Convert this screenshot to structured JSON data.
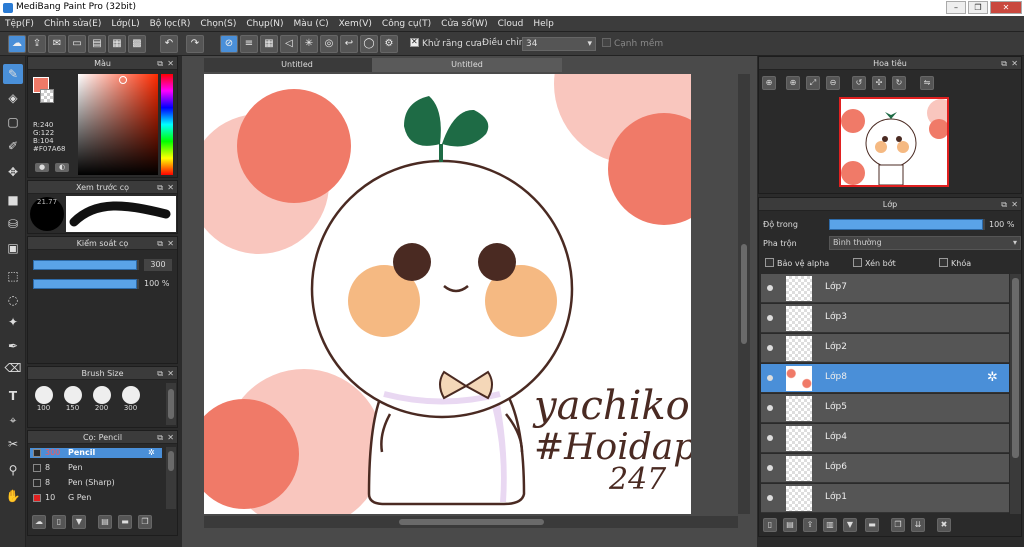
{
  "window": {
    "title": "MediBang Paint Pro (32bit)"
  },
  "menu": [
    "Tệp(F)",
    "Chỉnh sửa(E)",
    "Lớp(L)",
    "Bộ lọc(R)",
    "Chọn(S)",
    "Chụp(N)",
    "Màu (C)",
    "Xem(V)",
    "Công cụ(T)",
    "Cửa sổ(W)",
    "Cloud",
    "Help"
  ],
  "toolbar": {
    "antialias_label": "Khử răng cưa",
    "correction_label": "Điều chỉnh",
    "correction_value": "34",
    "edge_label": "Cạnh mềm"
  },
  "color_panel": {
    "title": "Màu",
    "r": "R:240",
    "g": "G:122",
    "b": "B:104",
    "hex": "#F07A68",
    "primary": "#F07A68"
  },
  "brush_preview": {
    "title": "Xem trước cọ",
    "size": "21.77"
  },
  "brush_control": {
    "title": "Kiểm soát cọ",
    "size": "300",
    "opacity": "100 %",
    "size_fraction": 1.0,
    "opacity_fraction": 1.0
  },
  "brush_size": {
    "title": "Brush Size",
    "sizes": [
      "100",
      "150",
      "200",
      "300"
    ]
  },
  "brush_list": {
    "title": "Cọ: Pencil",
    "items": [
      {
        "size": "300",
        "name": "Pencil",
        "color": "#2a2a2a",
        "selected": true
      },
      {
        "size": "8",
        "name": "Pen",
        "color": "#2a2a2a",
        "selected": false
      },
      {
        "size": "8",
        "name": "Pen (Sharp)",
        "color": "#2a2a2a",
        "selected": false
      },
      {
        "size": "10",
        "name": "G Pen",
        "color": "#e02020",
        "selected": false
      }
    ]
  },
  "canvas": {
    "tabs": [
      "Untitled",
      "Untitled"
    ],
    "signature_lines": [
      "yachiko",
      "#Hoidap",
      "247"
    ]
  },
  "navigator": {
    "title": "Hoa tiêu"
  },
  "layers": {
    "title": "Lớp",
    "opacity_label": "Độ trong",
    "opacity_value": "100 %",
    "opacity_fraction": 1.0,
    "blend_label": "Pha trộn",
    "blend_value": "Bình thường",
    "protect_alpha": "Bảo vệ alpha",
    "clipping": "Xén bớt",
    "lock": "Khóa",
    "items": [
      {
        "name": "Lớp7",
        "selected": false
      },
      {
        "name": "Lớp3",
        "selected": false
      },
      {
        "name": "Lớp2",
        "selected": false
      },
      {
        "name": "Lớp8",
        "selected": true
      },
      {
        "name": "Lớp5",
        "selected": false
      },
      {
        "name": "Lớp4",
        "selected": false
      },
      {
        "name": "Lớp6",
        "selected": false
      },
      {
        "name": "Lớp1",
        "selected": false
      }
    ]
  },
  "colors": {
    "accent": "#4a8fd8",
    "coral": "#F07A68",
    "pink": "#F9C6BE",
    "leaf": "#1E6B45",
    "outline": "#4A2A22",
    "cheek": "#F5B982"
  }
}
